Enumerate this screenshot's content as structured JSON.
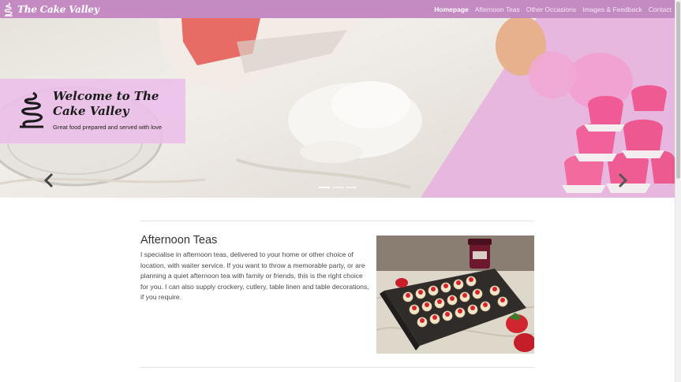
{
  "navbar": {
    "brand": "The Cake Valley",
    "links": [
      {
        "label": "Homepage",
        "active": true
      },
      {
        "label": "Afternoon Teas",
        "active": false
      },
      {
        "label": "Other Occasions",
        "active": false
      },
      {
        "label": "Images & Feedback",
        "active": false
      },
      {
        "label": "Contact",
        "active": false
      }
    ]
  },
  "hero": {
    "title": "Welcome to The Cake Valley",
    "subtitle": "Great food prepared and served with love",
    "slides": 3,
    "active_slide": 0
  },
  "section": {
    "title": "Afternoon Teas",
    "text": "I specialise in afternoon teas, delivered to your home or other choice of location, with waiter service. If you want to throw a memorable party, or are planning a quiet afternoon tea with family or friends, this is the right choice for you. I can also supply crockery, cutlery, table linen and table decorations, if you require."
  },
  "colors": {
    "navbar": "#c48bc3",
    "caption": "#ecbeea",
    "accent": "#e85d8c"
  }
}
